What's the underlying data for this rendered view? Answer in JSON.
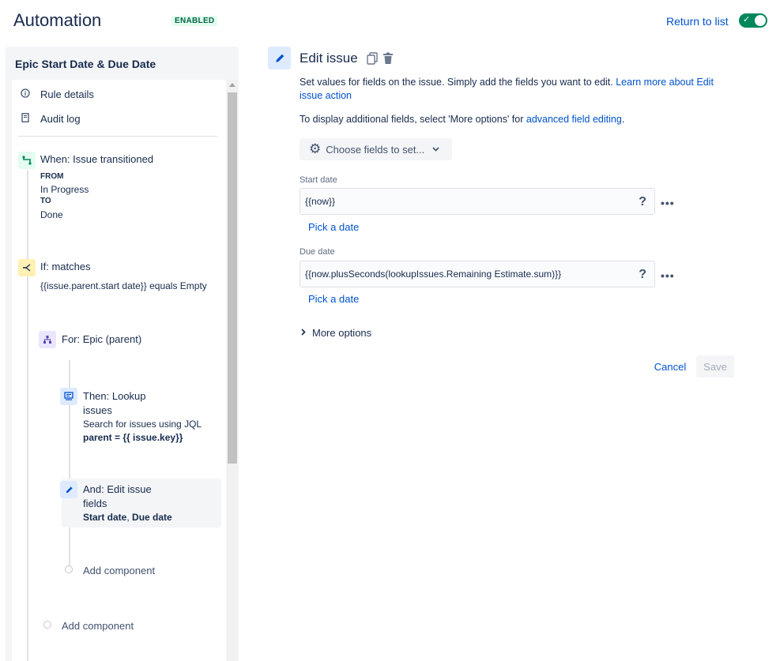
{
  "header": {
    "title": "Automation",
    "status_badge": "ENABLED",
    "return_link": "Return to list",
    "toggle_state": "on",
    "accent_color": "#00875a"
  },
  "rule": {
    "name": "Epic Start Date & Due Date",
    "nav": [
      {
        "label": "Rule details",
        "icon": "info-icon"
      },
      {
        "label": "Audit log",
        "icon": "document-icon"
      }
    ],
    "trigger": {
      "title": "When: Issue transitioned",
      "from_label": "FROM",
      "from_value": "In Progress",
      "to_label": "TO",
      "to_value": "Done"
    },
    "condition": {
      "title": "If: matches",
      "detail": "{{issue.parent.start date}} equals Empty"
    },
    "branch": {
      "title": "For: Epic (parent)"
    },
    "lookup": {
      "title_line1": "Then: Lookup",
      "title_line2": "issues",
      "detail": "Search for issues using JQL",
      "jql": "parent = {{ issue.key}}"
    },
    "edit": {
      "title_line1": "And: Edit issue",
      "title_line2": "fields",
      "field1": "Start date",
      "sep": ", ",
      "field2": "Due date"
    },
    "add_component_inner": "Add component",
    "add_component_outer": "Add component"
  },
  "editor": {
    "title": "Edit issue",
    "description": "Set values for fields on the issue. Simply add the fields you want to edit. ",
    "description_link": "Learn more about Edit issue action",
    "description2": "To display additional fields, select 'More options' for ",
    "description2_link": "advanced field editing",
    "description2_end": ".",
    "choose_fields": "Choose fields to set...",
    "fields": [
      {
        "label": "Start date",
        "value": "{{now}}",
        "pick": "Pick a date"
      },
      {
        "label": "Due date",
        "value": "{{now.plusSeconds(lookupIssues.Remaining Estimate.sum)}}",
        "pick": "Pick a date"
      }
    ],
    "help_glyph": "?",
    "more_glyph": "•••",
    "more_options": "More options",
    "cancel": "Cancel",
    "save": "Save"
  }
}
